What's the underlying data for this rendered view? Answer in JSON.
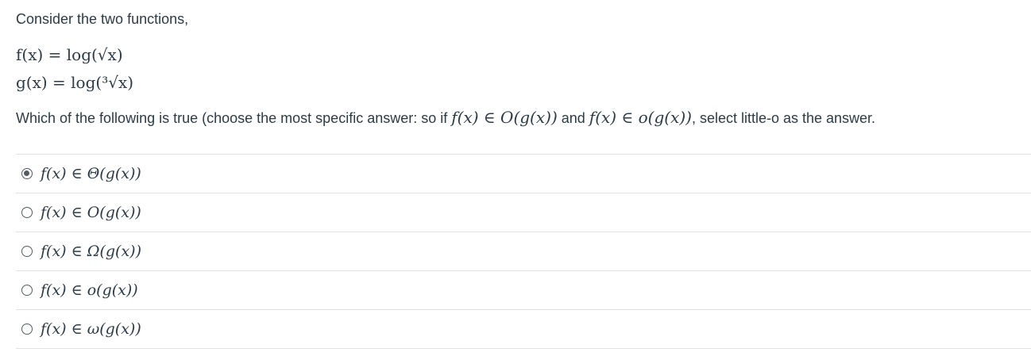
{
  "intro": "Consider the two functions,",
  "formulas": {
    "f": "f(x) = log(√x)",
    "g": "g(x) = log(³√x)"
  },
  "question": {
    "prefix": "Which of the following is true (choose the most specific answer: so if ",
    "expr1": "f(x) ∈ O(g(x))",
    "middle": " and ",
    "expr2": "f(x) ∈ o(g(x))",
    "suffix": ", select little-o as the answer."
  },
  "answers": [
    {
      "label": "f(x) ∈ Θ(g(x))",
      "selected": true
    },
    {
      "label": "f(x) ∈ O(g(x))",
      "selected": false
    },
    {
      "label": "f(x) ∈ Ω(g(x))",
      "selected": false
    },
    {
      "label": "f(x) ∈ o(g(x))",
      "selected": false
    },
    {
      "label": "f(x) ∈ ω(g(x))",
      "selected": false
    }
  ]
}
